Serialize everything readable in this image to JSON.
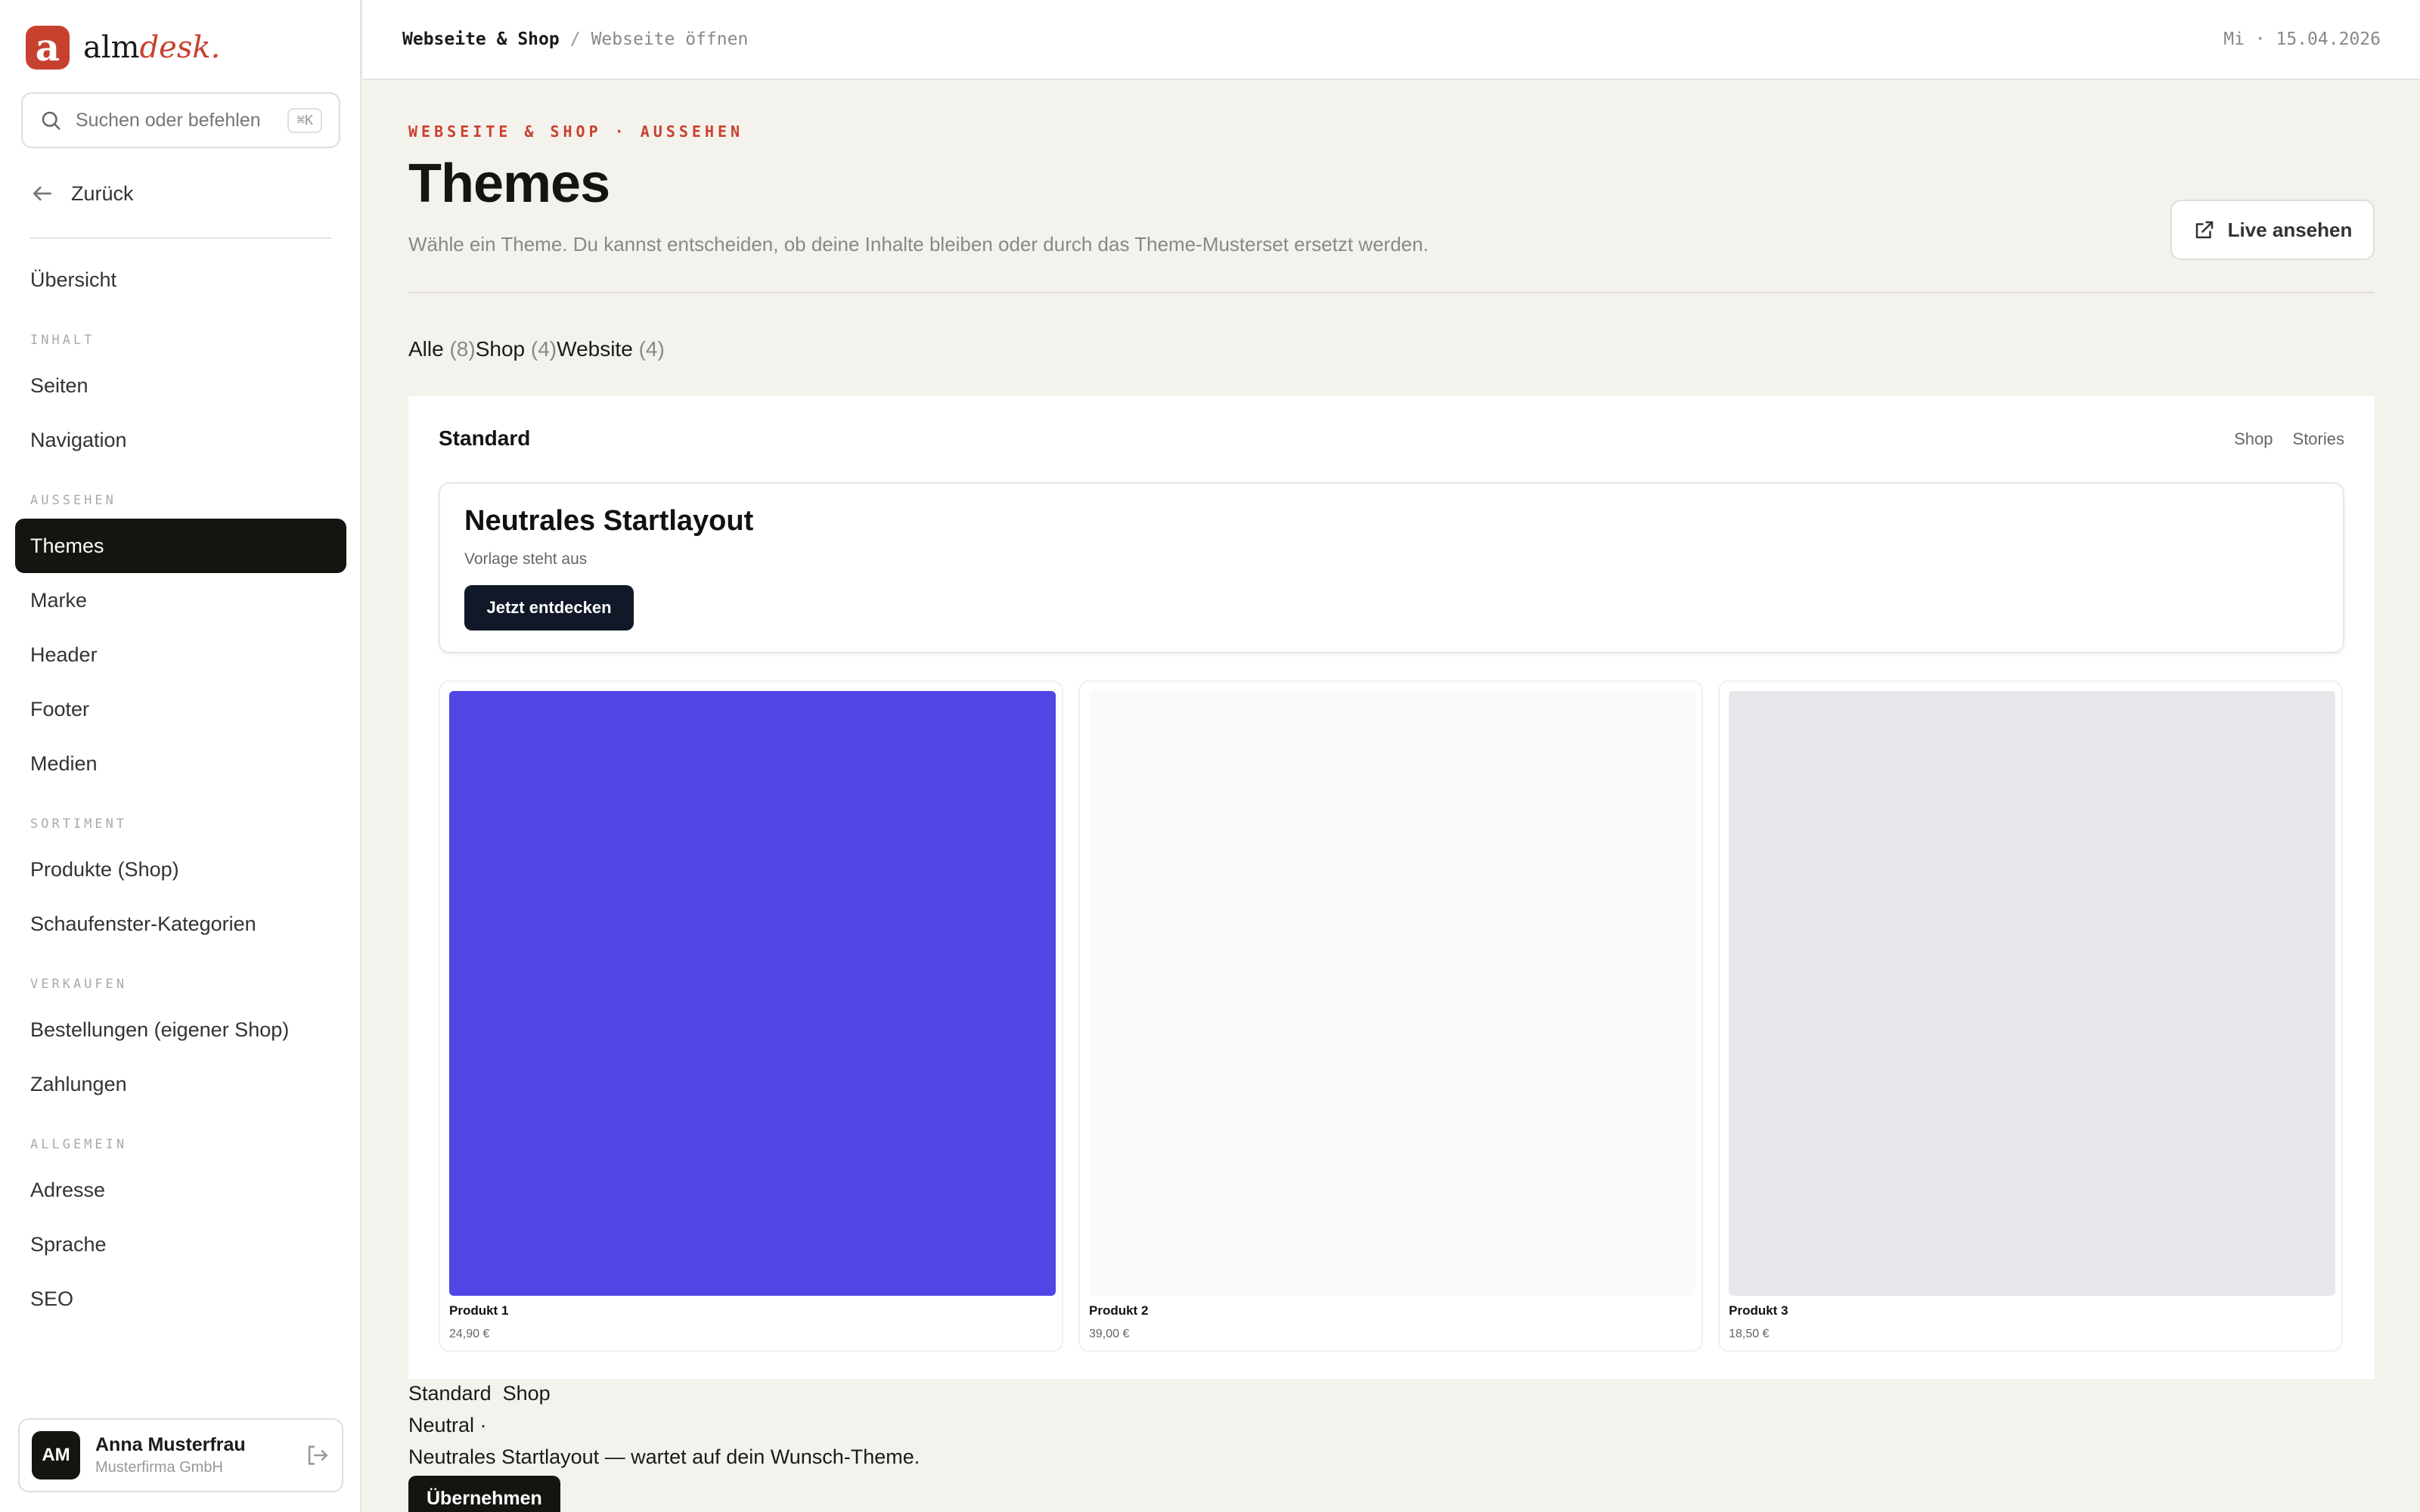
{
  "app": {
    "logo_letter": "a",
    "logo_text_main": "alm",
    "logo_text_accent": "desk."
  },
  "search": {
    "placeholder": "Suchen oder befehlen",
    "shortcut": "⌘K"
  },
  "sidebar": {
    "back_label": "Zurück",
    "overview": "Übersicht",
    "sections": [
      {
        "title": "INHALT",
        "items": [
          "Seiten",
          "Navigation"
        ]
      },
      {
        "title": "AUSSEHEN",
        "items": [
          "Themes",
          "Marke",
          "Header",
          "Footer",
          "Medien"
        ]
      },
      {
        "title": "SORTIMENT",
        "items": [
          "Produkte (Shop)",
          "Schaufenster-Kategorien"
        ]
      },
      {
        "title": "VERKAUFEN",
        "items": [
          "Bestellungen (eigener Shop)",
          "Zahlungen"
        ]
      },
      {
        "title": "ALLGEMEIN",
        "items": [
          "Adresse",
          "Sprache",
          "SEO"
        ]
      }
    ],
    "active_item": "Themes"
  },
  "user": {
    "initials": "AM",
    "name": "Anna Musterfrau",
    "company": "Musterfirma GmbH"
  },
  "topbar": {
    "crumb_1": "Webseite & Shop",
    "separator": "/",
    "crumb_2": "Webseite öffnen",
    "date": "Mi · 15.04.2026"
  },
  "page": {
    "eyebrow": "WEBSEITE & SHOP · AUSSEHEN",
    "title": "Themes",
    "description": "Wähle ein Theme. Du kannst entscheiden, ob deine Inhalte bleiben oder durch das Theme-Musterset ersetzt werden.",
    "live_button": "Live ansehen"
  },
  "filters": [
    {
      "label": "Alle",
      "count": "(8)"
    },
    {
      "label": "Shop",
      "count": "(4)"
    },
    {
      "label": "Website",
      "count": "(4)"
    }
  ],
  "preview": {
    "title": "Standard",
    "nav": [
      "Shop",
      "Stories"
    ],
    "hero_title": "Neutrales Startlayout",
    "hero_subtitle": "Vorlage steht aus",
    "hero_cta": "Jetzt entdecken",
    "products": [
      {
        "name": "Produkt 1",
        "price": "24,90 €",
        "color": "#4f46e5"
      },
      {
        "name": "Produkt 2",
        "price": "39,00 €",
        "color": "#f9fafb"
      },
      {
        "name": "Produkt 3",
        "price": "18,50 €",
        "color": "#e5e7eb"
      }
    ]
  },
  "theme_card": {
    "name": "Standard",
    "tag": "Shop",
    "style_label": "Neutral ·",
    "description": "Neutrales Startlayout — wartet auf dein Wunsch-Theme.",
    "apply_button": "Übernehmen"
  },
  "colors": {
    "accent": "#c8412f",
    "active_nav_bg": "#161410",
    "background": "#f4f2ec"
  }
}
